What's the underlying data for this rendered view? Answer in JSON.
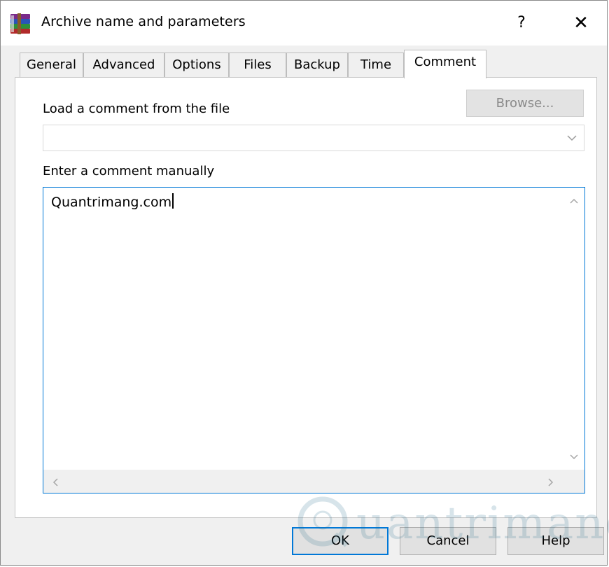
{
  "window": {
    "title": "Archive name and parameters",
    "help_glyph": "?",
    "close_glyph": "✕"
  },
  "tabs": [
    {
      "label": "General",
      "active": false
    },
    {
      "label": "Advanced",
      "active": false
    },
    {
      "label": "Options",
      "active": false
    },
    {
      "label": "Files",
      "active": false
    },
    {
      "label": "Backup",
      "active": false
    },
    {
      "label": "Time",
      "active": false
    },
    {
      "label": "Comment",
      "active": true
    }
  ],
  "comment_tab": {
    "load_label": "Load a comment from the file",
    "browse_label": "Browse...",
    "file_value": "",
    "manual_label": "Enter a comment manually",
    "comment_text": "Quantrimang.com"
  },
  "buttons": {
    "ok": "OK",
    "cancel": "Cancel",
    "help": "Help"
  },
  "watermark": {
    "text": "uantrimang"
  },
  "icons": {
    "app": "winrar-books-icon",
    "combo_arrow": "chevron-down-icon"
  },
  "colors": {
    "focus_border": "#0078d7",
    "dialog_bg": "#f0f0f0",
    "disabled_text": "#8a8a8a"
  }
}
